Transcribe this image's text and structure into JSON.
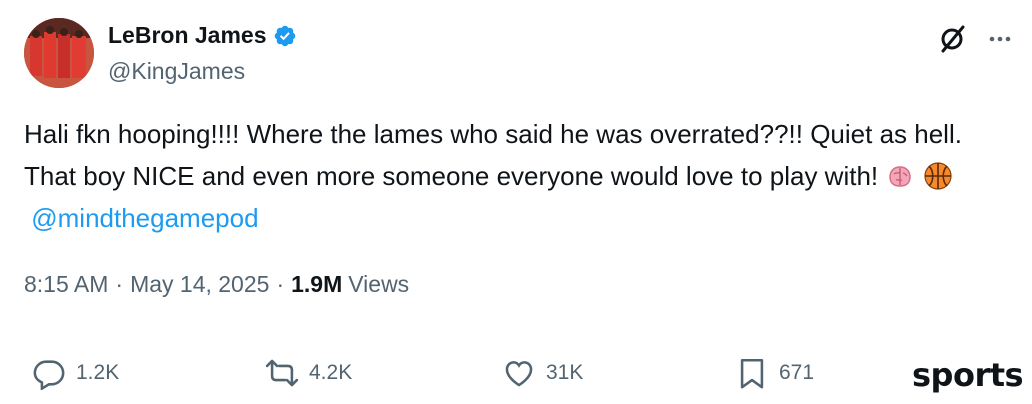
{
  "author": {
    "display_name": "LeBron James",
    "handle": "@KingJames",
    "verified_icon": "verified-badge-icon",
    "verified_color": "#1d9bf0"
  },
  "header_actions": {
    "grok_icon": "grok-icon",
    "more_icon": "more-icon"
  },
  "tweet": {
    "text_part1": "Hali fkn hooping!!!! Where the lames who said he was overrated??!! Quiet as hell. That boy NICE and even more someone everyone would love to play with! ",
    "emoji_1": "brain-emoji",
    "emoji_2": "basketball-emoji",
    "mention": "@mindthegamepod"
  },
  "meta": {
    "time": "8:15 AM",
    "date": "May 14, 2025",
    "separator": "·",
    "views_count": "1.9M",
    "views_label": "Views"
  },
  "actions": {
    "reply_count": "1.2K",
    "repost_count": "4.2K",
    "like_count": "31K",
    "bookmark_count": "671"
  },
  "watermark": {
    "text": "sports"
  },
  "colors": {
    "text": "#0f1419",
    "secondary": "#536471",
    "accent": "#1d9bf0"
  }
}
